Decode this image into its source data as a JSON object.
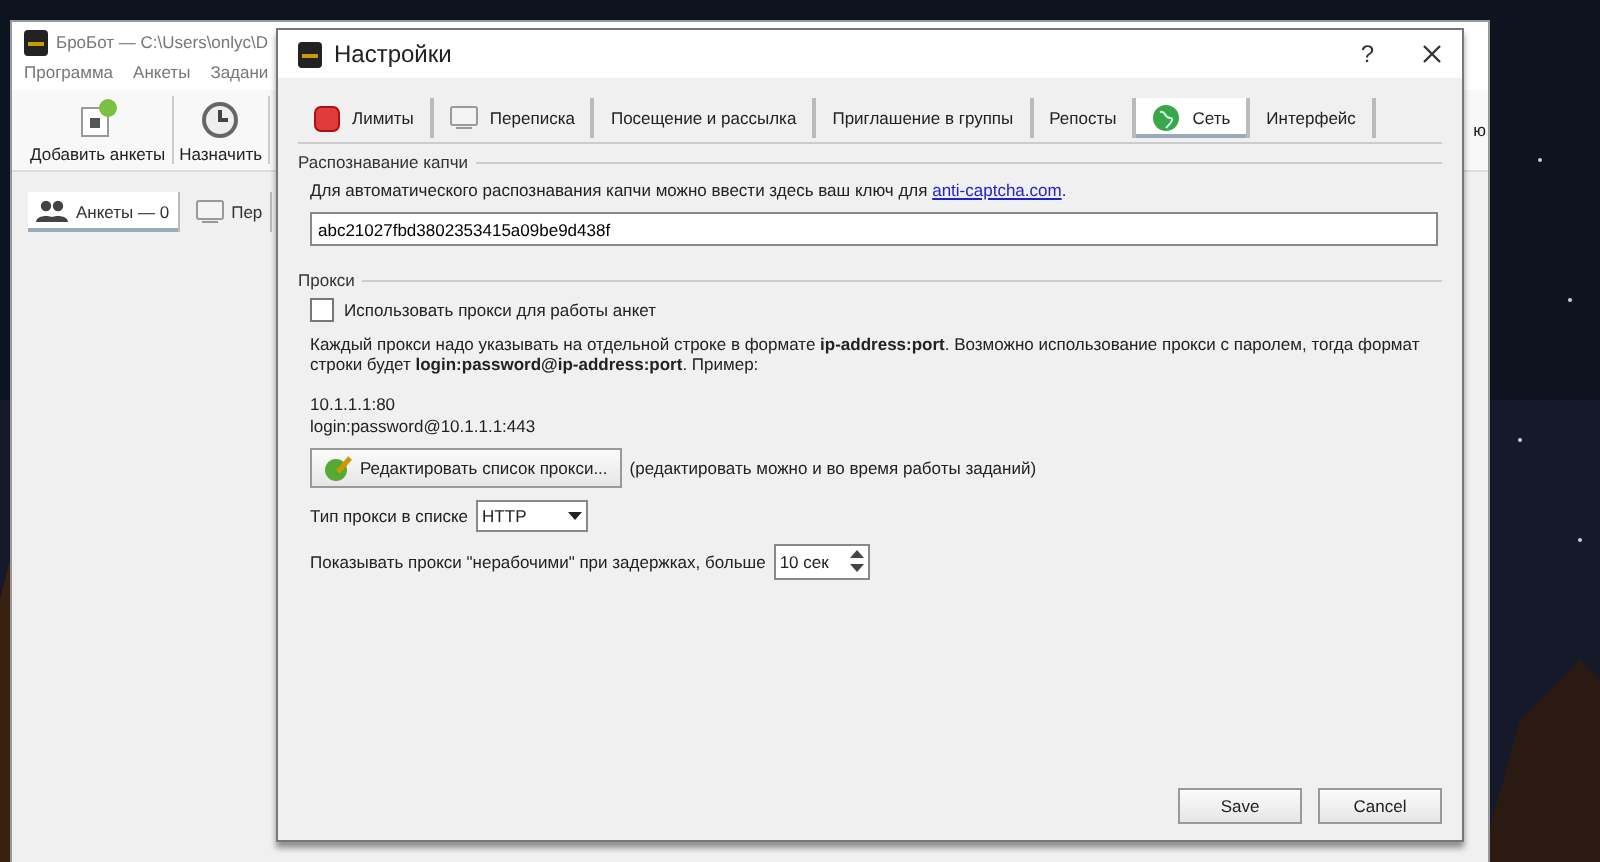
{
  "main_window": {
    "title": "БроБот — C:\\Users\\onlyc\\D",
    "menu": [
      "Программа",
      "Анкеты",
      "Задани"
    ],
    "toolbar": [
      {
        "label": "Добавить анкеты",
        "kind": "add"
      },
      {
        "label": "Назначить",
        "kind": "clock"
      }
    ],
    "toolbar_tail": "ю",
    "tabs": [
      {
        "label": "Анкеты — 0",
        "selected": true,
        "kind": "users"
      },
      {
        "label": "Пер",
        "selected": false,
        "kind": "chat"
      }
    ]
  },
  "dialog": {
    "title": "Настройки",
    "help": "?",
    "tabs": [
      {
        "label": "Лимиты",
        "selected": false,
        "kind": "stop"
      },
      {
        "label": "Переписка",
        "selected": false,
        "kind": "chat"
      },
      {
        "label": "Посещение и рассылка",
        "selected": false,
        "kind": "plain"
      },
      {
        "label": "Приглашение в группы",
        "selected": false,
        "kind": "plain"
      },
      {
        "label": "Репосты",
        "selected": false,
        "kind": "plain"
      },
      {
        "label": "Сеть",
        "selected": true,
        "kind": "globe"
      },
      {
        "label": "Интерфейс",
        "selected": false,
        "kind": "plain"
      }
    ],
    "captcha": {
      "title": "Распознавание капчи",
      "description": "Для автоматического распознавания капчи можно ввести здесь ваш ключ для ",
      "link": "anti-captcha.com",
      "description_end": ".",
      "key": "abc21027fbd3802353415a09be9d438f"
    },
    "proxy": {
      "title": "Прокси",
      "use_proxy": {
        "label": "Использовать прокси для работы анкет",
        "checked": false
      },
      "description": "Каждый прокси надо указывать на отдельной строке в формате **ip-address:port**. Возможно использование прокси с паролем, тогда формат строки будет **login:password@ip-address:port**. Пример:",
      "examples": [
        "10.1.1.1:80",
        "login:password@10.1.1.1:443"
      ],
      "edit_button": "Редактировать список прокси...",
      "edit_note": "(редактировать можно и во время работы заданий)",
      "type_label": "Тип прокси в списке",
      "type_value": "HTTP",
      "delay_label": "Показывать прокси \"нерабочими\" при задержках, больше",
      "delay_value": "10 сек"
    },
    "buttons": [
      "Save",
      "Cancel"
    ]
  }
}
